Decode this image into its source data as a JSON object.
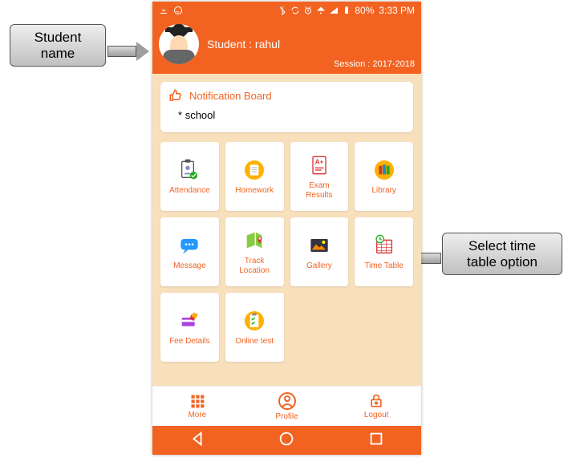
{
  "callouts": {
    "left": "Student\nname",
    "right": "Select time\ntable option"
  },
  "statusbar": {
    "battery_pct": "80%",
    "time": "3:33 PM"
  },
  "header": {
    "student_label": "Student : rahul",
    "session": "Session : 2017-2018"
  },
  "notification": {
    "title": "Notification Board",
    "bullet": "*",
    "text": "school"
  },
  "tiles": [
    {
      "label": "Attendance",
      "icon": "attendance-icon"
    },
    {
      "label": "Homework",
      "icon": "homework-icon"
    },
    {
      "label": "Exam\nResults",
      "icon": "exam-icon"
    },
    {
      "label": "Library",
      "icon": "library-icon"
    },
    {
      "label": "Message",
      "icon": "message-icon"
    },
    {
      "label": "Track\nLocation",
      "icon": "track-icon"
    },
    {
      "label": "Gallery",
      "icon": "gallery-icon"
    },
    {
      "label": "Time Table",
      "icon": "timetable-icon"
    },
    {
      "label": "Fee Details",
      "icon": "fee-icon"
    },
    {
      "label": "Online test",
      "icon": "test-icon"
    }
  ],
  "bottombar": {
    "more": "More",
    "profile": "Profile",
    "logout": "Logout"
  }
}
